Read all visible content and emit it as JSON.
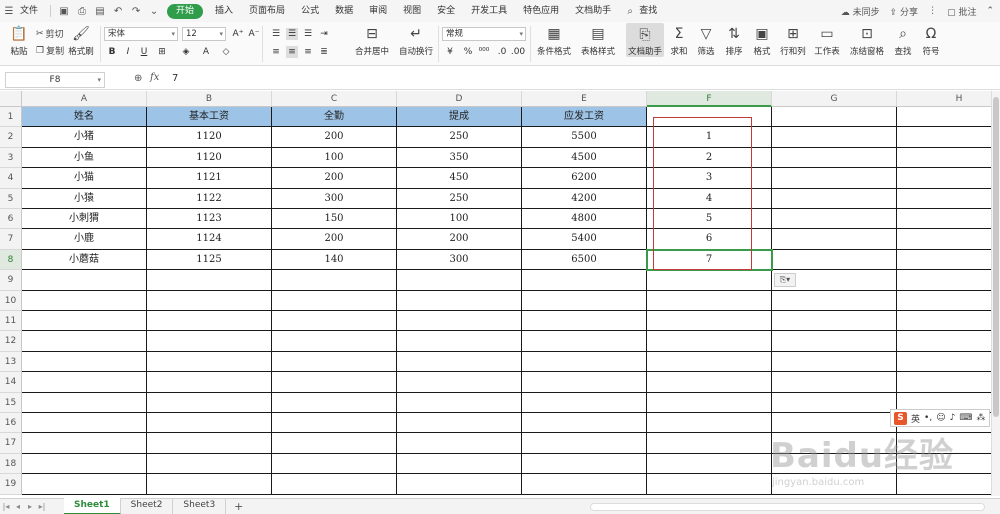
{
  "menubar": {
    "file_label": "文件",
    "tabs": [
      {
        "label": "开始",
        "active": true
      },
      {
        "label": "插入"
      },
      {
        "label": "页面布局"
      },
      {
        "label": "公式"
      },
      {
        "label": "数据"
      },
      {
        "label": "审阅"
      },
      {
        "label": "视图"
      },
      {
        "label": "安全"
      },
      {
        "label": "开发工具"
      },
      {
        "label": "特色应用"
      },
      {
        "label": "文档助手"
      }
    ],
    "search_label": "查找",
    "sync_label": "未同步",
    "share_label": "分享",
    "comment_label": "批注"
  },
  "ribbon": {
    "paste_label": "粘贴",
    "cut_label": "剪切",
    "copy_label": "复制",
    "format_painter_label": "格式刷",
    "font_name": "宋体",
    "font_size": "12",
    "merge_label": "合并居中",
    "wrap_label": "自动换行",
    "number_format": "常规",
    "cond_format_label": "条件格式",
    "table_style_label": "表格样式",
    "doc_helper_label": "文档助手",
    "sum_label": "求和",
    "filter_label": "筛选",
    "sort_label": "排序",
    "format_label": "格式",
    "rowcol_label": "行和列",
    "sheet_label": "工作表",
    "freeze_label": "冻结窗格",
    "find_label": "查找",
    "symbol_label": "符号"
  },
  "formula_bar": {
    "cell_ref": "F8",
    "fx": "fx",
    "value": "7"
  },
  "columns": [
    "A",
    "B",
    "C",
    "D",
    "E",
    "F",
    "G",
    "H"
  ],
  "rows": [
    "1",
    "2",
    "3",
    "4",
    "5",
    "6",
    "7",
    "8",
    "9",
    "10",
    "11",
    "12",
    "13",
    "14",
    "15",
    "16",
    "17",
    "18",
    "19"
  ],
  "table": {
    "headers": [
      "姓名",
      "基本工资",
      "全勤",
      "提成",
      "应发工资"
    ],
    "rows": [
      [
        "小猪",
        "1120",
        "200",
        "250",
        "5500",
        "1"
      ],
      [
        "小鱼",
        "1120",
        "100",
        "350",
        "4500",
        "2"
      ],
      [
        "小猫",
        "1121",
        "200",
        "450",
        "6200",
        "3"
      ],
      [
        "小猿",
        "1122",
        "300",
        "250",
        "4200",
        "4"
      ],
      [
        "小刺猬",
        "1123",
        "150",
        "100",
        "4800",
        "5"
      ],
      [
        "小鹿",
        "1124",
        "200",
        "200",
        "5400",
        "6"
      ],
      [
        "小蘑菇",
        "1125",
        "140",
        "300",
        "6500",
        "7"
      ]
    ]
  },
  "sheets": [
    {
      "label": "Sheet1",
      "active": true
    },
    {
      "label": "Sheet2"
    },
    {
      "label": "Sheet3"
    }
  ],
  "ime": {
    "lang": "英"
  },
  "watermark": {
    "main": "Baidu经验",
    "sub": "jingyan.baidu.com"
  },
  "colors": {
    "accent": "#2f9d4a",
    "header_fill": "#9dc3e6",
    "selection": "#3a9a47",
    "highlight_box": "#c0393b"
  }
}
